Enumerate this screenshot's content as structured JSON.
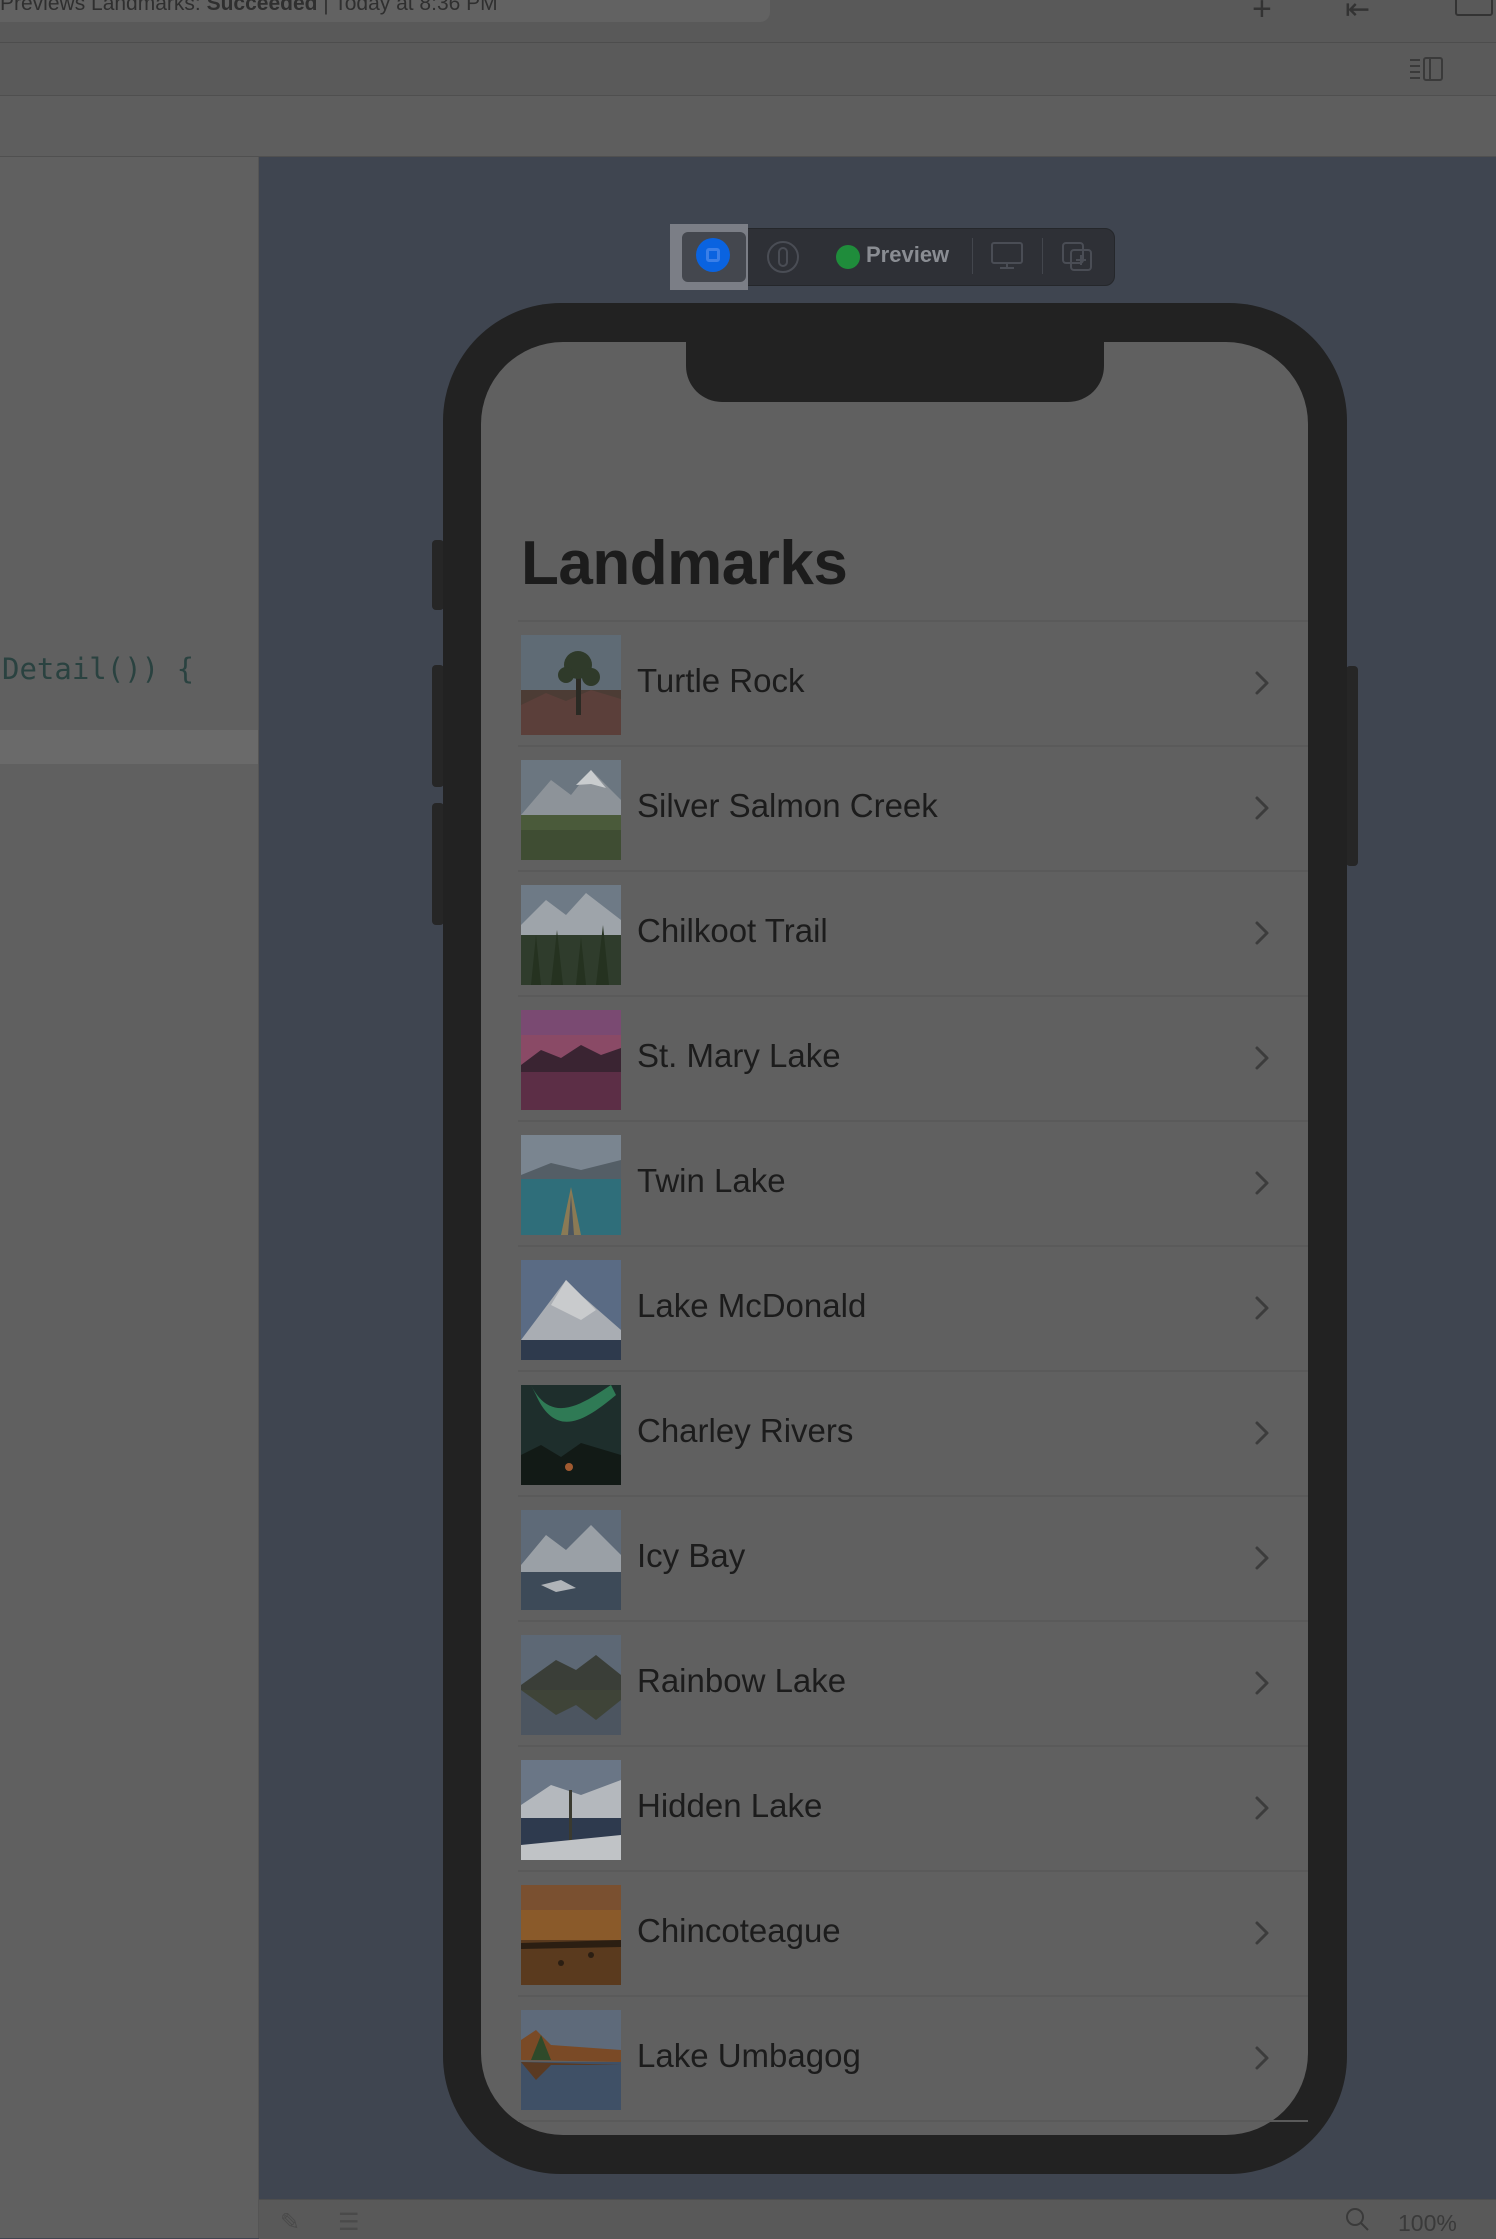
{
  "status": {
    "scheme": "Previews Landmarks: ",
    "result": "Succeeded",
    "time": " | Today at 8:36 PM"
  },
  "toolbar": {
    "add_icon": "+",
    "nav_icon": "⇤"
  },
  "editor": {
    "code_line": "Detail()) {"
  },
  "preview_toolbar": {
    "status_label": "Preview",
    "status_color": "#1f8c3b",
    "live_color": "#0a63e0"
  },
  "app": {
    "title": "Landmarks",
    "landmarks": [
      {
        "name": "Turtle Rock",
        "thumb": "desert-tree"
      },
      {
        "name": "Silver Salmon Creek",
        "thumb": "mountain-meadow"
      },
      {
        "name": "Chilkoot Trail",
        "thumb": "forest-mountains"
      },
      {
        "name": "St. Mary Lake",
        "thumb": "pink-sunset-lake"
      },
      {
        "name": "Twin Lake",
        "thumb": "kayak-lake"
      },
      {
        "name": "Lake McDonald",
        "thumb": "snow-peak"
      },
      {
        "name": "Charley Rivers",
        "thumb": "aurora"
      },
      {
        "name": "Icy Bay",
        "thumb": "glacier-bay"
      },
      {
        "name": "Rainbow Lake",
        "thumb": "mountain-reflection"
      },
      {
        "name": "Hidden Lake",
        "thumb": "snowy-lake"
      },
      {
        "name": "Chincoteague",
        "thumb": "sunset-marsh"
      },
      {
        "name": "Lake Umbagog",
        "thumb": "autumn-lake"
      }
    ]
  },
  "bottom": {
    "zoom": "100%"
  }
}
